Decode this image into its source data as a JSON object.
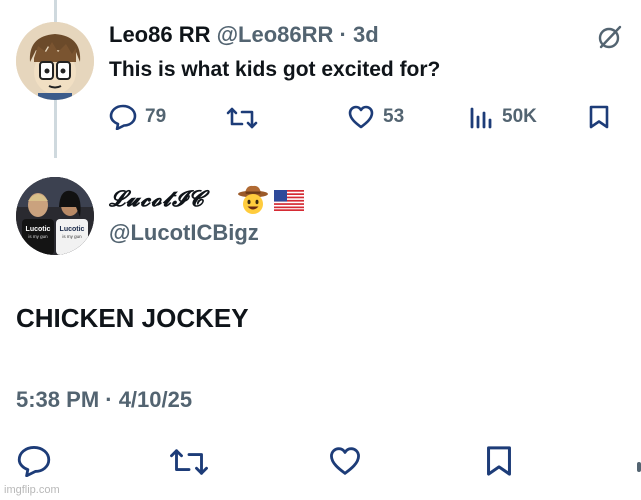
{
  "parent_post": {
    "display_name": "Leo86 RR",
    "handle": "@Leo86RR",
    "separator": "·",
    "age": "3d",
    "text": "This is what kids got excited for?",
    "replies": "79",
    "likes": "53",
    "views": "50K"
  },
  "main_post": {
    "display_name": "𝓛𝓾𝓬𝓸𝓽𝓘𝓒",
    "handle": "@LucotICBigz",
    "text": "CHICKEN JOCKEY",
    "timestamp": "5:38 PM · 4/10/25"
  },
  "avatar_main": {
    "shirt_text": "Lucotic",
    "shirt_sub": "is my gun"
  },
  "watermark": "imgflip.com",
  "colors": {
    "text_primary": "#0f1419",
    "text_secondary": "#536471",
    "thread_line": "#cfd9de",
    "accent_icons": "#1d3c78"
  },
  "icons": [
    "reply-icon",
    "repost-icon",
    "like-icon",
    "views-icon",
    "bookmark-icon",
    "grok-icon",
    "cowboy-emoji-icon",
    "us-flag-icon"
  ]
}
